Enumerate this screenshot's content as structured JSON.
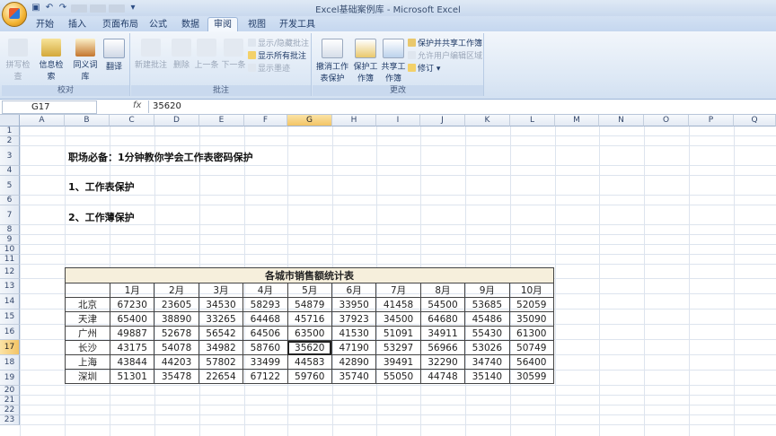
{
  "window": {
    "title": "Excel基础案例库 - Microsoft Excel"
  },
  "tabs": [
    "开始",
    "插入",
    "页面布局",
    "公式",
    "数据",
    "审阅",
    "视图",
    "开发工具"
  ],
  "active_tab": "审阅",
  "ribbon": {
    "proofing": {
      "label": "校对",
      "buttons": [
        "拼写检查",
        "信息检索",
        "同义词库",
        "翻译"
      ]
    },
    "comments": {
      "label": "批注",
      "buttons": [
        "新建批注",
        "删除",
        "上一条",
        "下一条"
      ],
      "small": [
        "显示/隐藏批注",
        "显示所有批注",
        "显示墨迹"
      ]
    },
    "changes": {
      "label": "更改",
      "buttons": [
        "撤消工作表保护",
        "保护工作簿",
        "共享工作簿"
      ],
      "small": [
        "保护并共享工作簿",
        "允许用户编辑区域",
        "修订"
      ]
    }
  },
  "formula_bar": {
    "name_box": "G17",
    "fx": "fx",
    "value": "35620"
  },
  "columns": [
    "A",
    "B",
    "C",
    "D",
    "E",
    "F",
    "G",
    "H",
    "I",
    "J",
    "K",
    "L",
    "M",
    "N",
    "O",
    "P",
    "Q"
  ],
  "selected_column": "G",
  "rows": [
    "1",
    "2",
    "3",
    "4",
    "5",
    "6",
    "7",
    "8",
    "9",
    "10",
    "11",
    "12",
    "13",
    "14",
    "15",
    "16",
    "17",
    "18",
    "19",
    "20",
    "21",
    "22",
    "23"
  ],
  "selected_row": "17",
  "sheet_text": {
    "heading": "职场必备：1分钟教你学会工作表密码保护",
    "item1": "1、工作表保护",
    "item2": "2、工作薄保护"
  },
  "table": {
    "title": "各城市销售额统计表",
    "headers": [
      "",
      "1月",
      "2月",
      "3月",
      "4月",
      "5月",
      "6月",
      "7月",
      "8月",
      "9月",
      "10月"
    ],
    "rows": [
      [
        "北京",
        "67230",
        "23605",
        "34530",
        "58293",
        "54879",
        "33950",
        "41458",
        "54500",
        "53685",
        "52059"
      ],
      [
        "天津",
        "65400",
        "38890",
        "33265",
        "64468",
        "45716",
        "37923",
        "34500",
        "64680",
        "45486",
        "35090"
      ],
      [
        "广州",
        "49887",
        "52678",
        "56542",
        "64506",
        "63500",
        "41530",
        "51091",
        "34911",
        "55430",
        "61300"
      ],
      [
        "长沙",
        "43175",
        "54078",
        "34982",
        "58760",
        "35620",
        "47190",
        "53297",
        "56966",
        "53026",
        "50749"
      ],
      [
        "上海",
        "43844",
        "44203",
        "57802",
        "33499",
        "44583",
        "42890",
        "39491",
        "32290",
        "34740",
        "56400"
      ],
      [
        "深圳",
        "51301",
        "35478",
        "22654",
        "67122",
        "59760",
        "35740",
        "55050",
        "44748",
        "35140",
        "30599"
      ]
    ]
  }
}
